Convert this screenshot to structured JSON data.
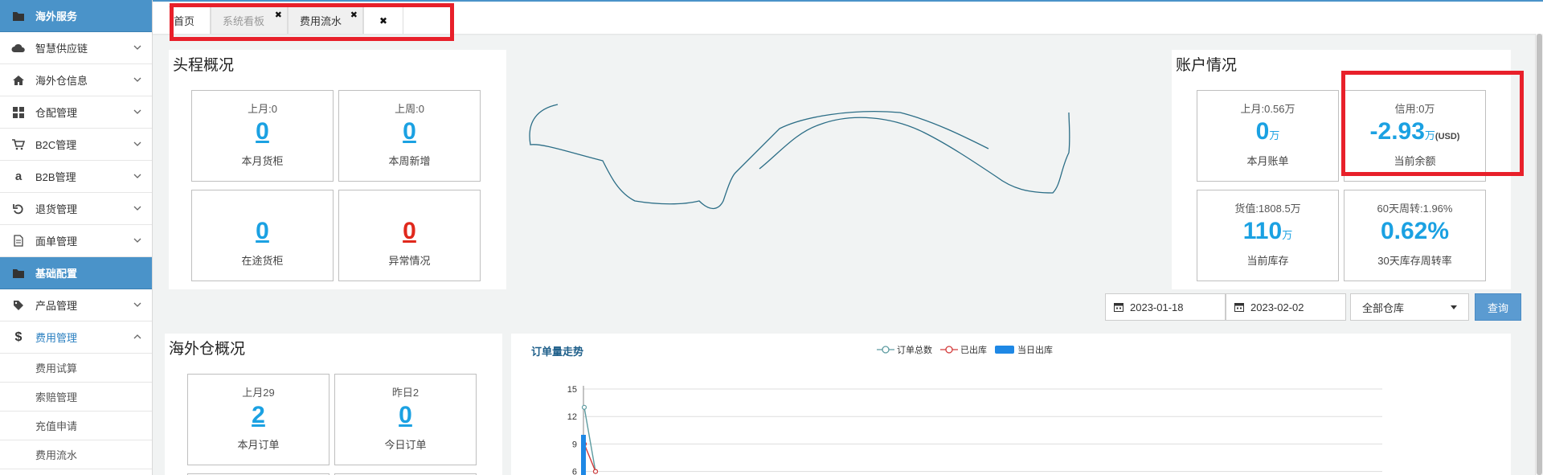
{
  "sidebar": {
    "items": [
      {
        "label": "海外服务",
        "icon": "folder-icon",
        "type": "section"
      },
      {
        "label": "智慧供应链",
        "icon": "cloud-icon",
        "type": "menu",
        "expanded": false
      },
      {
        "label": "海外仓信息",
        "icon": "home-icon",
        "type": "menu",
        "expanded": false
      },
      {
        "label": "仓配管理",
        "icon": "grid-icon",
        "type": "menu",
        "expanded": false
      },
      {
        "label": "B2C管理",
        "icon": "cart-icon",
        "type": "menu",
        "expanded": false
      },
      {
        "label": "B2B管理",
        "icon": "amazon-icon",
        "type": "menu",
        "expanded": false
      },
      {
        "label": "退货管理",
        "icon": "undo-icon",
        "type": "menu",
        "expanded": false
      },
      {
        "label": "面单管理",
        "icon": "document-icon",
        "type": "menu",
        "expanded": false
      },
      {
        "label": "基础配置",
        "icon": "folder-icon",
        "type": "section"
      },
      {
        "label": "产品管理",
        "icon": "tag-icon",
        "type": "menu",
        "expanded": false
      },
      {
        "label": "费用管理",
        "icon": "dollar-icon",
        "type": "menu",
        "expanded": true
      }
    ],
    "subitems": [
      "费用试算",
      "索赔管理",
      "充值申请",
      "费用流水"
    ]
  },
  "tabs": [
    {
      "label": "首页"
    },
    {
      "label": "系统看板",
      "close": "✖"
    },
    {
      "label": "费用流水",
      "close": "✖"
    },
    {
      "label": "",
      "close": "✖"
    }
  ],
  "headrun": {
    "title": "头程概况",
    "cards": [
      {
        "caption": "上月:0",
        "value": "0",
        "label": "本月货柜",
        "style": "ul"
      },
      {
        "caption": "上周:0",
        "value": "0",
        "label": "本周新增",
        "style": "ul"
      },
      {
        "caption": "",
        "value": "0",
        "label": "在途货柜",
        "style": "ul"
      },
      {
        "caption": "",
        "value": "0",
        "label": "异常情况",
        "style": "red"
      }
    ]
  },
  "account": {
    "title": "账户情况",
    "cards": [
      {
        "caption": "上月:0.56万",
        "value": "0",
        "unit": "万",
        "label": "本月账单"
      },
      {
        "caption": "信用:0万",
        "value": "-2.93",
        "unit": "万",
        "unit2": "(USD)",
        "label": "当前余额"
      },
      {
        "caption": "货值:1808.5万",
        "value": "110",
        "unit": "万",
        "label": "当前库存"
      },
      {
        "caption": "60天周转:1.96%",
        "value": "0.62%",
        "unit": "",
        "label": "30天库存周转率"
      }
    ]
  },
  "filters": {
    "start_date": "2023-01-18",
    "end_date": "2023-02-02",
    "warehouse": "全部仓库",
    "query_label": "查询"
  },
  "overseas": {
    "title": "海外仓概况",
    "cards": [
      {
        "caption": "上月29",
        "value": "2",
        "label": "本月订单"
      },
      {
        "caption": "昨日2",
        "value": "0",
        "label": "今日订单"
      }
    ]
  },
  "trend": {
    "title": "订单量走势",
    "legend": [
      "订单总数",
      "已出库",
      "当日出库"
    ]
  },
  "chart_data": {
    "type": "line",
    "title": "订单量走势",
    "ylim": [
      0,
      15
    ],
    "yticks": [
      6,
      9,
      12,
      15
    ],
    "series": [
      {
        "name": "订单总数",
        "type": "line",
        "color": "#5c9ba0",
        "values": [
          13,
          6
        ]
      },
      {
        "name": "已出库",
        "type": "line",
        "color": "#d33a3a",
        "values": [
          9,
          6
        ]
      },
      {
        "name": "当日出库",
        "type": "bar",
        "color": "#1e88e5",
        "values": [
          10
        ]
      }
    ]
  },
  "colors": {
    "accent": "#4a93c9",
    "highlight": "#e8202a",
    "value_blue": "#1ba1e2",
    "value_red": "#e0281c"
  }
}
